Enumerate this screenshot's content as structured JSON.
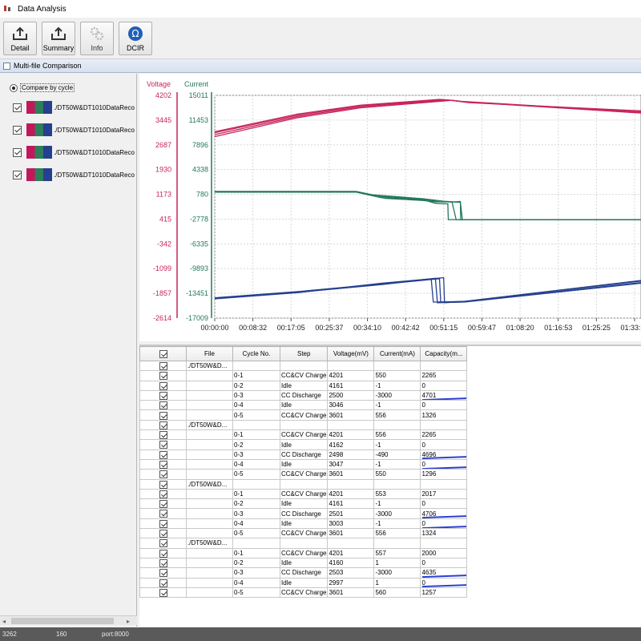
{
  "window": {
    "title": "Data Analysis"
  },
  "toolbar": {
    "buttons": [
      {
        "label": "Detail",
        "icon": "upload-tray-icon"
      },
      {
        "label": "Summary",
        "icon": "upload-tray-icon"
      },
      {
        "label": "Info",
        "icon": "gears-icon"
      },
      {
        "label": "DCIR",
        "icon": "omega-icon"
      }
    ]
  },
  "section": {
    "title": "Multi-file Comparison"
  },
  "left_panel": {
    "compare_label": "Compare by cycle",
    "files": [
      "./DT50W&DT1010DataReco",
      "./DT50W&DT1010DataReco",
      "./DT50W&DT1010DataReco",
      "./DT50W&DT1010DataReco"
    ]
  },
  "chart_data": {
    "type": "line",
    "title": "",
    "y_left_label": "Voltage",
    "y_right_label": "Current",
    "voltage_ticks": [
      "4202",
      "3445",
      "2687",
      "1930",
      "1173",
      "415",
      "-342",
      "-1099",
      "-1857",
      "-2614"
    ],
    "current_ticks": [
      "15011",
      "11453",
      "7896",
      "4338",
      "780",
      "-2778",
      "-6335",
      "-9893",
      "-13451",
      "-17009"
    ],
    "x_ticks": [
      "00:00:00",
      "00:08:32",
      "00:17:05",
      "00:25:37",
      "00:34:10",
      "00:42:42",
      "00:51:15",
      "00:59:47",
      "01:08:20",
      "01:16:53",
      "01:25:25",
      "01:33:58"
    ],
    "x_range_min": [
      0,
      102.4
    ],
    "voltage_range": [
      -2614,
      4202
    ],
    "current_range": [
      -17009,
      15011
    ],
    "grid": true,
    "colors": {
      "voltage": "#c7245a",
      "current": "#23785a",
      "capacity": "#24408e"
    },
    "series": [
      {
        "kind": "voltage",
        "points": [
          [
            0,
            3060
          ],
          [
            20,
            3600
          ],
          [
            35,
            3880
          ],
          [
            55,
            4070
          ],
          [
            58,
            4040
          ],
          [
            60,
            4000
          ],
          [
            100,
            3680
          ],
          [
            102.4,
            3660
          ]
        ]
      },
      {
        "kind": "voltage",
        "points": [
          [
            0,
            3000
          ],
          [
            20,
            3560
          ],
          [
            35,
            3850
          ],
          [
            56,
            4060
          ],
          [
            60,
            4000
          ],
          [
            100,
            3700
          ],
          [
            102.4,
            3690
          ]
        ]
      },
      {
        "kind": "voltage",
        "points": [
          [
            0,
            2940
          ],
          [
            20,
            3520
          ],
          [
            35,
            3820
          ],
          [
            57,
            4050
          ],
          [
            61,
            3980
          ],
          [
            100,
            3740
          ],
          [
            102.4,
            3730
          ]
        ]
      },
      {
        "kind": "voltage",
        "points": [
          [
            0,
            3090
          ],
          [
            20,
            3630
          ],
          [
            35,
            3900
          ],
          [
            54,
            4080
          ],
          [
            59,
            4020
          ],
          [
            100,
            3710
          ],
          [
            102.4,
            3700
          ]
        ]
      },
      {
        "kind": "current",
        "points": [
          [
            0,
            1100
          ],
          [
            34,
            1100
          ],
          [
            40,
            300
          ],
          [
            50,
            0
          ],
          [
            53,
            -500
          ],
          [
            56,
            -600
          ],
          [
            56.1,
            -2850
          ],
          [
            102.4,
            -2850
          ]
        ]
      },
      {
        "kind": "current",
        "points": [
          [
            0,
            1200
          ],
          [
            34,
            1200
          ],
          [
            38,
            700
          ],
          [
            50,
            150
          ],
          [
            55,
            -200
          ],
          [
            57,
            -300
          ],
          [
            58,
            -2850
          ],
          [
            102.4,
            -2850
          ]
        ]
      },
      {
        "kind": "current",
        "points": [
          [
            0,
            1150
          ],
          [
            34,
            1150
          ],
          [
            39,
            500
          ],
          [
            50,
            100
          ],
          [
            54,
            -300
          ],
          [
            59,
            -350
          ],
          [
            59.5,
            -2850
          ],
          [
            102.4,
            -2850
          ]
        ]
      },
      {
        "kind": "current",
        "points": [
          [
            0,
            1100
          ],
          [
            34,
            1100
          ],
          [
            41,
            200
          ],
          [
            50,
            -100
          ],
          [
            53,
            -300
          ],
          [
            58,
            -300
          ],
          [
            59,
            -250
          ],
          [
            59.1,
            -2850
          ],
          [
            102.4,
            -2850
          ]
        ]
      },
      {
        "kind": "capacity",
        "points": [
          [
            0,
            -14200
          ],
          [
            20,
            -13300
          ],
          [
            40,
            -12200
          ],
          [
            52,
            -11400
          ],
          [
            52.5,
            -14700
          ],
          [
            60,
            -14600
          ],
          [
            102.4,
            -11700
          ]
        ]
      },
      {
        "kind": "capacity",
        "points": [
          [
            0,
            -14100
          ],
          [
            20,
            -13200
          ],
          [
            40,
            -12100
          ],
          [
            53,
            -11300
          ],
          [
            53.5,
            -14800
          ],
          [
            60,
            -14700
          ],
          [
            102.4,
            -12000
          ]
        ]
      },
      {
        "kind": "capacity",
        "points": [
          [
            0,
            -14250
          ],
          [
            20,
            -13350
          ],
          [
            40,
            -12000
          ],
          [
            55,
            -11200
          ],
          [
            55.2,
            -14800
          ],
          [
            60,
            -14600
          ],
          [
            102.4,
            -11600
          ]
        ]
      },
      {
        "kind": "capacity",
        "points": [
          [
            0,
            -14150
          ],
          [
            20,
            -13250
          ],
          [
            40,
            -12150
          ],
          [
            54,
            -11350
          ],
          [
            54.3,
            -14750
          ],
          [
            62,
            -14550
          ],
          [
            102.4,
            -11900
          ]
        ]
      }
    ]
  },
  "table": {
    "headers": [
      "",
      "File",
      "Cycle No.",
      "Step",
      "Voltage(mV)",
      "Current(mA)",
      "Capacity(m..."
    ],
    "rows": [
      {
        "file": "./DT50W&D...",
        "cycle": "",
        "step": "",
        "voltage": "",
        "current": "",
        "capacity": ""
      },
      {
        "file": "",
        "cycle": "0-1",
        "step": "CC&CV Charge",
        "voltage": "4201",
        "current": "550",
        "capacity": "2265"
      },
      {
        "file": "",
        "cycle": "0-2",
        "step": "Idle",
        "voltage": "4161",
        "current": "-1",
        "capacity": "0"
      },
      {
        "file": "",
        "cycle": "0-3",
        "step": "CC Discharge",
        "voltage": "2500",
        "current": "-3000",
        "capacity": "4701"
      },
      {
        "file": "",
        "cycle": "0-4",
        "step": "Idle",
        "voltage": "3046",
        "current": "-1",
        "capacity": "0"
      },
      {
        "file": "",
        "cycle": "0-5",
        "step": "CC&CV Charge",
        "voltage": "3601",
        "current": "556",
        "capacity": "1326"
      },
      {
        "file": "./DT50W&D...",
        "cycle": "",
        "step": "",
        "voltage": "",
        "current": "",
        "capacity": ""
      },
      {
        "file": "",
        "cycle": "0-1",
        "step": "CC&CV Charge",
        "voltage": "4201",
        "current": "556",
        "capacity": "2265"
      },
      {
        "file": "",
        "cycle": "0-2",
        "step": "Idle",
        "voltage": "4162",
        "current": "-1",
        "capacity": "0"
      },
      {
        "file": "",
        "cycle": "0-3",
        "step": "CC Discharge",
        "voltage": "2498",
        "current": "-490",
        "capacity": "4696"
      },
      {
        "file": "",
        "cycle": "0-4",
        "step": "Idle",
        "voltage": "3047",
        "current": "-1",
        "capacity": "0"
      },
      {
        "file": "",
        "cycle": "0-5",
        "step": "CC&CV Charge",
        "voltage": "3601",
        "current": "550",
        "capacity": "1296"
      },
      {
        "file": "./DT50W&D...",
        "cycle": "",
        "step": "",
        "voltage": "",
        "current": "",
        "capacity": ""
      },
      {
        "file": "",
        "cycle": "0-1",
        "step": "CC&CV Charge",
        "voltage": "4201",
        "current": "553",
        "capacity": "2017"
      },
      {
        "file": "",
        "cycle": "0-2",
        "step": "Idle",
        "voltage": "4161",
        "current": "-1",
        "capacity": "0"
      },
      {
        "file": "",
        "cycle": "0-3",
        "step": "CC Discharge",
        "voltage": "2501",
        "current": "-3000",
        "capacity": "4706"
      },
      {
        "file": "",
        "cycle": "0-4",
        "step": "Idle",
        "voltage": "3003",
        "current": "-1",
        "capacity": "0"
      },
      {
        "file": "",
        "cycle": "0-5",
        "step": "CC&CV Charge",
        "voltage": "3601",
        "current": "556",
        "capacity": "1324"
      },
      {
        "file": "./DT50W&D...",
        "cycle": "",
        "step": "",
        "voltage": "",
        "current": "",
        "capacity": ""
      },
      {
        "file": "",
        "cycle": "0-1",
        "step": "CC&CV Charge",
        "voltage": "4201",
        "current": "557",
        "capacity": "2000"
      },
      {
        "file": "",
        "cycle": "0-2",
        "step": "Idle",
        "voltage": "4160",
        "current": "1",
        "capacity": "0"
      },
      {
        "file": "",
        "cycle": "0-3",
        "step": "CC Discharge",
        "voltage": "2503",
        "current": "-3000",
        "capacity": "4635"
      },
      {
        "file": "",
        "cycle": "0-4",
        "step": "Idle",
        "voltage": "2997",
        "current": "1",
        "capacity": "0"
      },
      {
        "file": "",
        "cycle": "0-5",
        "step": "CC&CV Charge",
        "voltage": "3601",
        "current": "560",
        "capacity": "1257"
      }
    ]
  },
  "status": {
    "left": "3262",
    "mid": "160",
    "port": "port:8000"
  }
}
